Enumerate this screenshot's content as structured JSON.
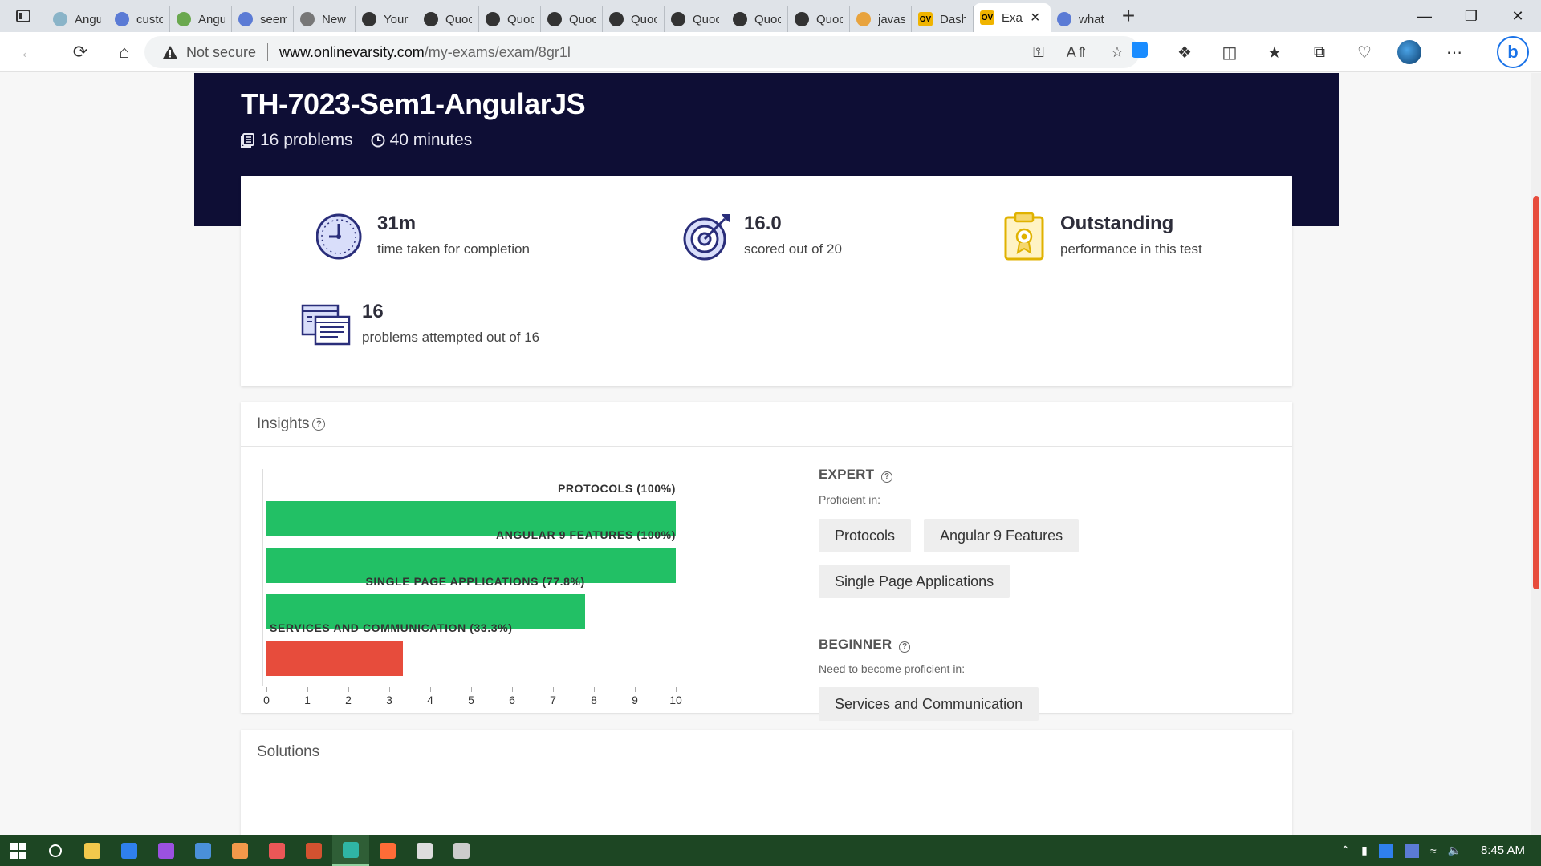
{
  "browser": {
    "tabs": [
      {
        "label": "Angula",
        "fav_color": "#8ab4c8"
      },
      {
        "label": "custon",
        "fav_color": "#5b7bd5"
      },
      {
        "label": "Angula",
        "fav_color": "#6aa84f"
      },
      {
        "label": "seemin",
        "fav_color": "#5b7bd5"
      },
      {
        "label": "New ta",
        "fav_color": "#777777"
      },
      {
        "label": "Your Re",
        "fav_color": "#333333"
      },
      {
        "label": "Quocar",
        "fav_color": "#333333"
      },
      {
        "label": "Quocar",
        "fav_color": "#333333"
      },
      {
        "label": "Quocar",
        "fav_color": "#333333"
      },
      {
        "label": "Quocar",
        "fav_color": "#333333"
      },
      {
        "label": "Quocar",
        "fav_color": "#333333"
      },
      {
        "label": "Quocar",
        "fav_color": "#333333"
      },
      {
        "label": "Quocar",
        "fav_color": "#333333"
      },
      {
        "label": "javascr",
        "fav_color": "#e8a33d"
      },
      {
        "label": "Dashbo",
        "fav_color": "#f0b400",
        "fav_text": "OV"
      },
      {
        "label": "Exa",
        "fav_color": "#f0b400",
        "fav_text": "OV",
        "active": true
      },
      {
        "label": "what p",
        "fav_color": "#5b7bd5"
      }
    ],
    "not_secure": "Not secure",
    "url_host": "www.onlinevarsity.com",
    "url_path": "/my-exams/exam/8gr1l"
  },
  "exam": {
    "title": "TH-7023-Sem1-AngularJS",
    "problems": "16 problems",
    "duration": "40 minutes"
  },
  "stats": {
    "time_value": "31m",
    "time_label": "time taken for completion",
    "score_value": "16.0",
    "score_label": "scored out of 20",
    "perf_value": "Outstanding",
    "perf_label": "performance in this test",
    "attempt_value": "16",
    "attempt_label": "problems attempted out of 16"
  },
  "insights": {
    "title": "Insights",
    "expert_title": "EXPERT",
    "expert_sub": "Proficient in:",
    "expert_chips": [
      "Protocols",
      "Angular 9 Features",
      "Single Page Applications"
    ],
    "beginner_title": "BEGINNER",
    "beginner_sub": "Need to become proficient in:",
    "beginner_chips": [
      "Services and Communication"
    ]
  },
  "chart_data": {
    "type": "bar",
    "orientation": "horizontal",
    "categories": [
      "PROTOCOLS (100%)",
      "ANGULAR 9 FEATURES (100%)",
      "SINGLE PAGE APPLICATIONS (77.8%)",
      "SERVICES AND COMMUNICATION (33.3%)"
    ],
    "values": [
      10,
      10,
      7.78,
      3.33
    ],
    "colors": [
      "#22c065",
      "#22c065",
      "#22c065",
      "#e74c3c"
    ],
    "xlim": [
      0,
      10
    ],
    "xticks": [
      "0",
      "1",
      "2",
      "3",
      "4",
      "5",
      "6",
      "7",
      "8",
      "9",
      "10"
    ]
  },
  "solutions": {
    "title": "Solutions"
  },
  "taskbar": {
    "clock": "8:45 AM",
    "apps": [
      {
        "name": "search",
        "color": "#ffffff"
      },
      {
        "name": "file-explorer",
        "color": "#f2c94c"
      },
      {
        "name": "vscode",
        "color": "#2f80ed"
      },
      {
        "name": "visual-studio",
        "color": "#9b51e0"
      },
      {
        "name": "python",
        "color": "#4a90d9"
      },
      {
        "name": "sublime",
        "color": "#f2994a"
      },
      {
        "name": "brave",
        "color": "#eb5757"
      },
      {
        "name": "powerpoint",
        "color": "#d35230"
      },
      {
        "name": "edge",
        "color": "#2fb5a4",
        "active": true
      },
      {
        "name": "postman",
        "color": "#ff6c37"
      },
      {
        "name": "settings",
        "color": "#dddddd"
      },
      {
        "name": "photos",
        "color": "#cccccc"
      }
    ]
  }
}
